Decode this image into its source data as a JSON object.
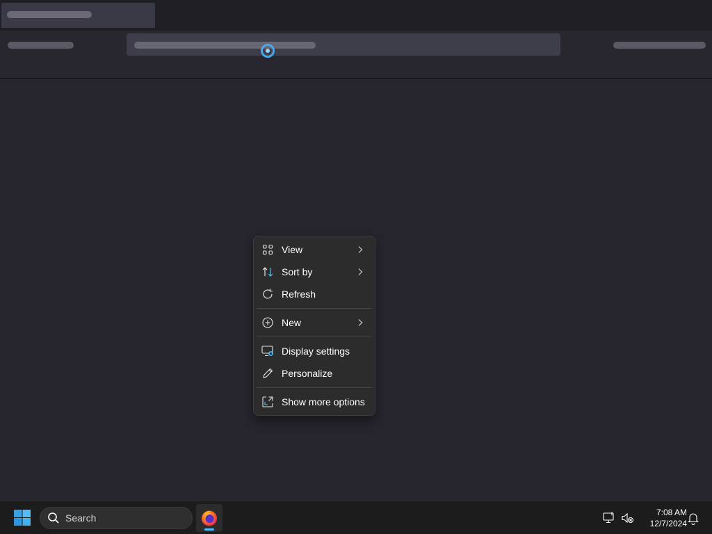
{
  "context_menu": {
    "items": [
      {
        "label": "View",
        "icon": "grid-icon",
        "submenu": true
      },
      {
        "label": "Sort by",
        "icon": "sort-icon",
        "submenu": true
      },
      {
        "label": "Refresh",
        "icon": "refresh-icon",
        "submenu": false
      },
      {
        "label": "New",
        "icon": "plus-circle-icon",
        "submenu": true
      },
      {
        "label": "Display settings",
        "icon": "display-settings-icon",
        "submenu": false
      },
      {
        "label": "Personalize",
        "icon": "pen-icon",
        "submenu": false
      },
      {
        "label": "Show more options",
        "icon": "expand-icon",
        "submenu": false
      }
    ]
  },
  "taskbar": {
    "search_label": "Search",
    "pinned_app_icon": "firefox-icon",
    "time": "7:08 AM",
    "date": "12/7/2024"
  },
  "colors": {
    "desktop_bg": "#27262f",
    "menu_bg": "#2c2c2c",
    "accent": "#4cc2ff",
    "taskbar_bg": "#1c1c1c"
  }
}
